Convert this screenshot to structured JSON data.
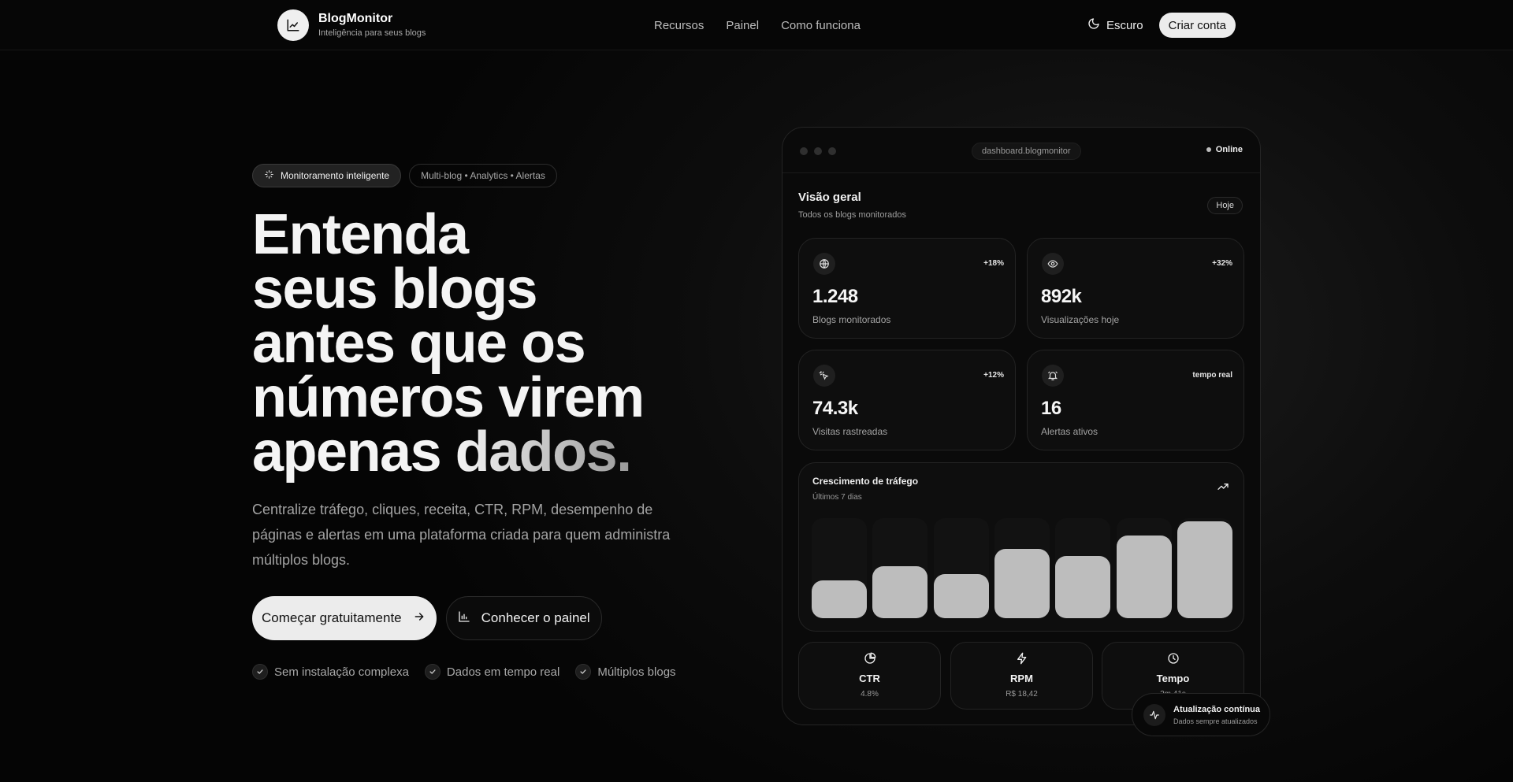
{
  "nav": {
    "brand_name": "BlogMonitor",
    "brand_tagline": "Inteligência para seus blogs",
    "links": [
      "Recursos",
      "Painel",
      "Como funciona"
    ],
    "theme_label": "Escuro",
    "cta_label": "Criar conta"
  },
  "hero": {
    "pill_primary": "Monitoramento inteligente",
    "pill_secondary": "Multi-blog • Analytics • Alertas",
    "headline": {
      "line1": "Entenda",
      "line2": "seus blogs",
      "line3": "antes que os",
      "line4": "números virem",
      "line5_prefix": "apenas ",
      "line5_fade": "dados."
    },
    "description": "Centralize tráfego, cliques, receita, CTR, RPM, desempenho de páginas e alertas em uma plataforma criada para quem administra múltiplos blogs.",
    "primary_button": "Começar gratuitamente",
    "secondary_button": "Conhecer o painel",
    "checks": [
      "Sem instalação complexa",
      "Dados em tempo real",
      "Múltiplos blogs"
    ]
  },
  "dashboard": {
    "url": "dashboard.blogmonitor",
    "status": "Online",
    "overview_title": "Visão geral",
    "overview_subtitle": "Todos os blogs monitorados",
    "period": "Hoje",
    "stats": [
      {
        "icon": "globe-icon",
        "badge": "+18%",
        "value": "1.248",
        "label": "Blogs monitorados"
      },
      {
        "icon": "eye-icon",
        "badge": "+32%",
        "value": "892k",
        "label": "Visualizações hoje"
      },
      {
        "icon": "pointer-click-icon",
        "badge": "+12%",
        "value": "74.3k",
        "label": "Visitas rastreadas"
      },
      {
        "icon": "bell-alert-icon",
        "badge": "tempo real",
        "value": "16",
        "label": "Alertas ativos"
      }
    ],
    "traffic": {
      "title": "Crescimento de tráfego",
      "subtitle": "Últimos 7 dias",
      "levels": [
        0.38,
        0.52,
        0.44,
        0.69,
        0.62,
        0.83,
        0.97
      ]
    },
    "metrics": [
      {
        "icon": "pie-chart-icon",
        "title": "CTR",
        "value": "4.8%"
      },
      {
        "icon": "lightning-icon",
        "title": "RPM",
        "value": "R$ 18,42"
      },
      {
        "icon": "clock-icon",
        "title": "Tempo",
        "value": "2m 41s"
      }
    ],
    "floating": {
      "title": "Atualização contínua",
      "subtitle": "Dados sempre atualizados"
    }
  },
  "colors": {
    "accent": "#ececec",
    "background": "#0a0a0a",
    "muted_text": "#a3a3a3",
    "bar_fill": "#bdbdbd"
  }
}
